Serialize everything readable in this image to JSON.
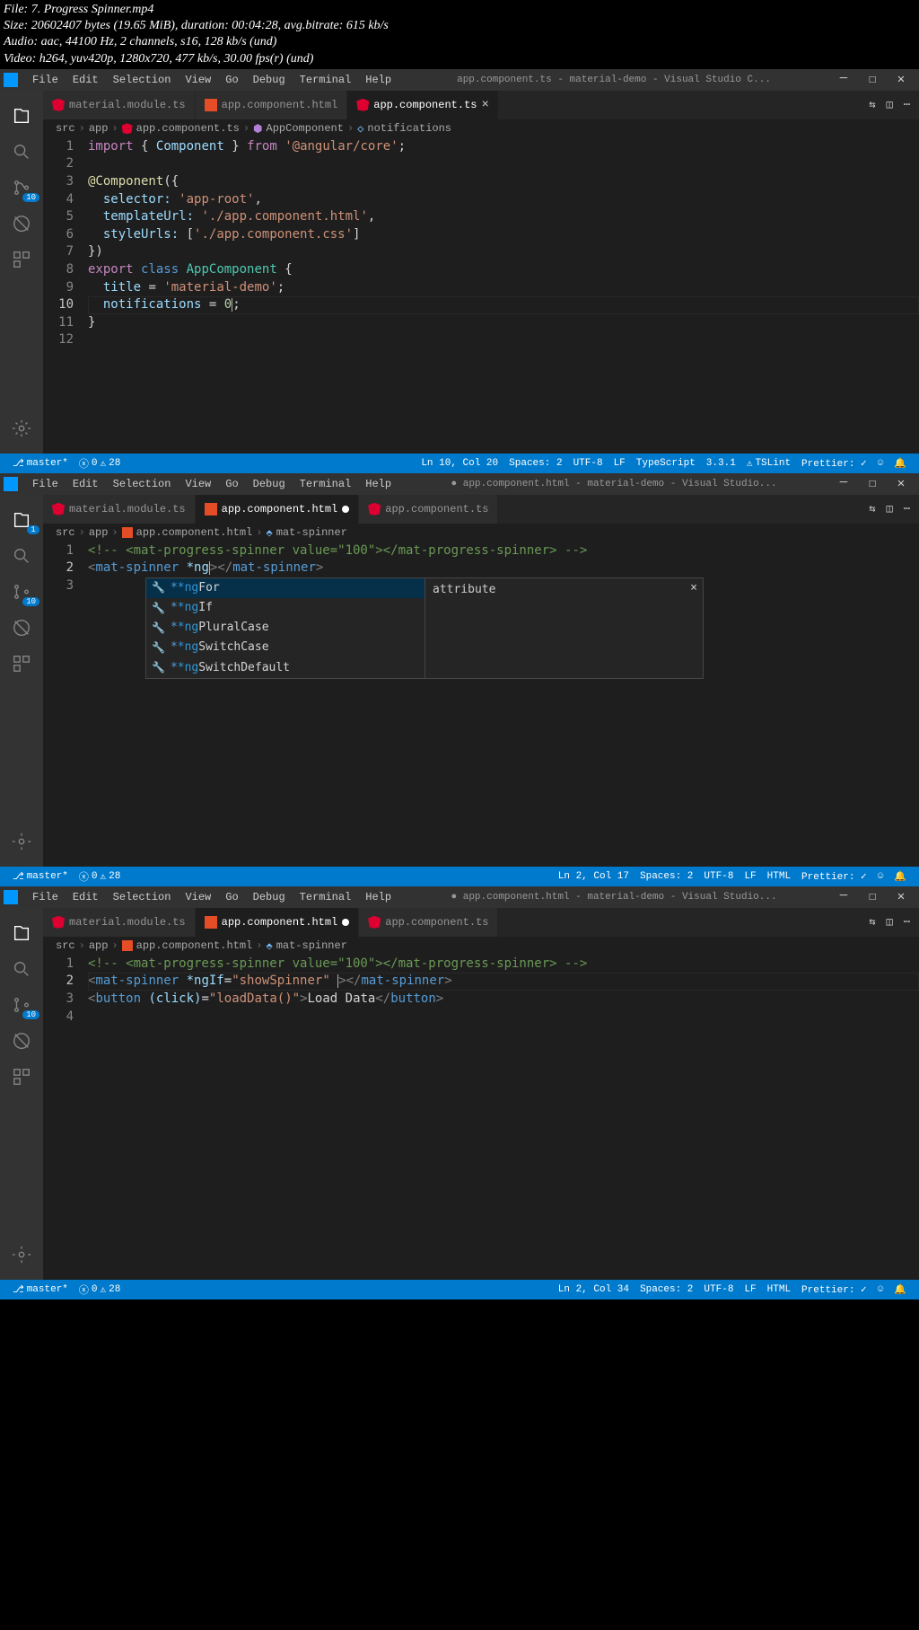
{
  "mediaInfo": {
    "file": "File: 7. Progress Spinner.mp4",
    "size": "Size: 20602407 bytes (19.65 MiB), duration: 00:04:28, avg.bitrate: 615 kb/s",
    "audio": "Audio: aac, 44100 Hz, 2 channels, s16, 128 kb/s (und)",
    "video": "Video: h264, yuv420p, 1280x720, 477 kb/s, 30.00 fps(r) (und)"
  },
  "menu": [
    "File",
    "Edit",
    "Selection",
    "View",
    "Go",
    "Debug",
    "Terminal",
    "Help"
  ],
  "pane1": {
    "title": "app.component.ts - material-demo - Visual Studio C...",
    "tabs": [
      {
        "label": "material.module.ts",
        "active": false,
        "icon": "ng"
      },
      {
        "label": "app.component.html",
        "active": false,
        "icon": "html"
      },
      {
        "label": "app.component.ts",
        "active": true,
        "icon": "ng",
        "close": true
      }
    ],
    "breadcrumb": [
      "src",
      "app",
      "app.component.ts",
      "AppComponent",
      "notifications"
    ],
    "scmBadge": "10",
    "status": {
      "branch": "master*",
      "errors": "0",
      "warnings": "28",
      "pos": "Ln 10, Col 20",
      "spaces": "Spaces: 2",
      "enc": "UTF-8",
      "eol": "LF",
      "lang": "TypeScript",
      "ver": "3.3.1",
      "tslint": "TSLint",
      "prettier": "Prettier: ✓"
    }
  },
  "pane2": {
    "title": "app.component.html - material-demo - Visual Studio...",
    "tabs": [
      {
        "label": "material.module.ts",
        "active": false,
        "icon": "ng"
      },
      {
        "label": "app.component.html",
        "active": true,
        "icon": "html",
        "dirty": true
      },
      {
        "label": "app.component.ts",
        "active": false,
        "icon": "ng"
      }
    ],
    "breadcrumb": [
      "src",
      "app",
      "app.component.html",
      "mat-spinner"
    ],
    "explorerBadge": "1",
    "scmBadge": "10",
    "autocomplete": {
      "items": [
        {
          "prefix": "*ng",
          "suffix": "For",
          "sel": true
        },
        {
          "prefix": "*ng",
          "suffix": "If"
        },
        {
          "prefix": "*ng",
          "suffix": "PluralCase"
        },
        {
          "prefix": "*ng",
          "suffix": "SwitchCase"
        },
        {
          "prefix": "*ng",
          "suffix": "SwitchDefault"
        }
      ],
      "doc": "attribute"
    },
    "status": {
      "branch": "master*",
      "errors": "0",
      "warnings": "28",
      "pos": "Ln 2, Col 17",
      "spaces": "Spaces: 2",
      "enc": "UTF-8",
      "eol": "LF",
      "lang": "HTML",
      "prettier": "Prettier: ✓"
    }
  },
  "pane3": {
    "title": "app.component.html - material-demo - Visual Studio...",
    "tabs": [
      {
        "label": "material.module.ts",
        "active": false,
        "icon": "ng"
      },
      {
        "label": "app.component.html",
        "active": true,
        "icon": "html",
        "dirty": true
      },
      {
        "label": "app.component.ts",
        "active": false,
        "icon": "ng"
      }
    ],
    "breadcrumb": [
      "src",
      "app",
      "app.component.html",
      "mat-spinner"
    ],
    "scmBadge": "10",
    "status": {
      "branch": "master*",
      "errors": "0",
      "warnings": "28",
      "pos": "Ln 2, Col 34",
      "spaces": "Spaces: 2",
      "enc": "UTF-8",
      "eol": "LF",
      "lang": "HTML",
      "prettier": "Prettier: ✓"
    }
  },
  "code1": {
    "1": "import { Component } from '@angular/core';",
    "9_title": "'material-demo'",
    "10_val": "0"
  }
}
